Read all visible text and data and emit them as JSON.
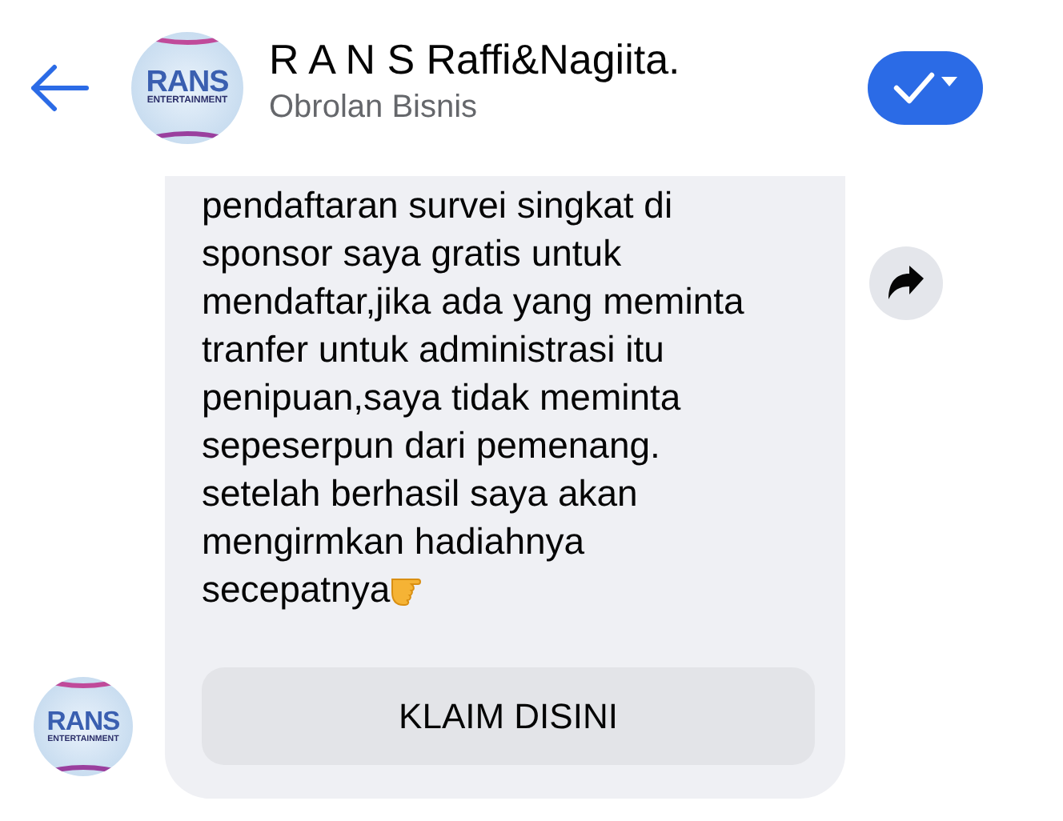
{
  "header": {
    "title": "R A N S Raffi&Nagiita.",
    "subtitle": "Obrolan Bisnis",
    "avatar": {
      "logo": "RANS",
      "logo_subtext": "ENTERTAINMENT"
    }
  },
  "message": {
    "lines": [
      "pendaftaran survei singkat di",
      "sponsor saya gratis untuk",
      "mendaftar,jika ada yang meminta",
      "tranfer untuk administrasi itu",
      "penipuan,saya tidak meminta",
      "sepeserpun dari pemenang.",
      "setelah berhasil saya akan",
      "mengirmkan hadiahnya",
      "secepatnya"
    ],
    "button": "KLAIM DISINI"
  },
  "sender_avatar": {
    "logo": "RANS",
    "logo_subtext": "ENTERTAINMENT"
  }
}
